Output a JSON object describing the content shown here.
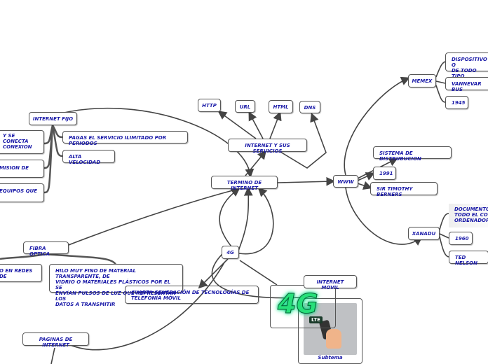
{
  "nodes": {
    "internet_fijo": "INTERNET FIJO",
    "fijo_left_1": "Y SE CONECTA\nCONEXION",
    "fijo_left_2": "MISION DE",
    "fijo_left_3": "EQUIPOS QUE",
    "pagas": "PAGAS EL SERVICIO ILIMITADO POR PERIODOS",
    "alta_velocidad": "ALTA VELOCIDAD",
    "termino": "TERMINO DE INTERNET",
    "servicios": "INTERNET Y SUS SERVICIOS",
    "http": "HTTP",
    "url": "URL",
    "html": "HTML",
    "dns": "DNS",
    "www": "WWW",
    "memex": "MEMEX",
    "dispositivo": "DISPOSITIVO Q\nDE TODO TIPO",
    "vannevar": "VANNEVAR BUS",
    "y1945": "1945",
    "sistema": "SISTEMA DE DISTRUBUCION",
    "y1991": "1991",
    "timothy": "SIR TIMOTHY BERNERS",
    "xanadu": "XANADU",
    "documento": "DOCUMENTO C\nTODO EL CONC\nORDENADORES",
    "y1960": "1960",
    "ted_nelson": "TED NELSON",
    "g4": "4G",
    "fibra": "FIBRA OPTICA",
    "fibra_left": "O EN REDES DE",
    "hilo": "HILO MUY FINO DE MATERIAL TRANSPARENTE, DE\nVIDRIO O MATERIALES PLÁSTICOS POR EL SE\nENVÍAN PULSOS DE LUZ QUE REPRESENTAN LOS\nDATOS A TRANSMITIR",
    "cuarta": "CUARTA GENERACIÓN DE TECNOLOGÍAS DE\nTELEFONÍA MÓVIL",
    "paginas": "PAGINAS DE INTERNET",
    "internet_movil": "INTERNET MOVIL",
    "subtema": "Subtema",
    "logo_text": "4G",
    "logo_lte": "LTE"
  },
  "colors": {
    "text": "#1a1aa8",
    "border": "#555555",
    "line": "#444444"
  }
}
